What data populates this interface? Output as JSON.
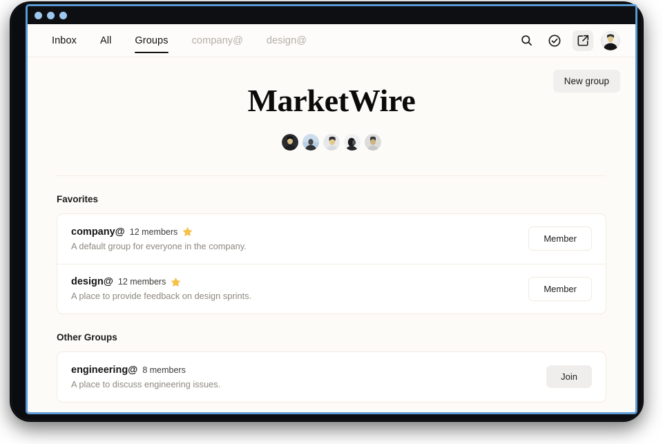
{
  "window": {
    "traffic_lights": [
      "close",
      "minimize",
      "maximize"
    ]
  },
  "nav": {
    "tabs": [
      {
        "label": "Inbox",
        "active": false,
        "muted": false
      },
      {
        "label": "All",
        "active": false,
        "muted": false
      },
      {
        "label": "Groups",
        "active": true,
        "muted": false
      },
      {
        "label": "company@",
        "active": false,
        "muted": true
      },
      {
        "label": "design@",
        "active": false,
        "muted": true
      }
    ],
    "actions": [
      {
        "icon": "search-icon",
        "label": "Search"
      },
      {
        "icon": "check-circle-icon",
        "label": "Done"
      },
      {
        "icon": "compose-icon",
        "label": "Compose"
      }
    ],
    "avatar": "user-avatar"
  },
  "hero": {
    "title": "MarketWire",
    "new_group_label": "New group",
    "member_avatar_count": 5
  },
  "sections": [
    {
      "title": "Favorites",
      "groups": [
        {
          "name": "company@",
          "members": "12 members",
          "favorite": true,
          "star": "★",
          "description": "A default group for everyone in the company.",
          "action_label": "Member",
          "action_style": "outline"
        },
        {
          "name": "design@",
          "members": "12 members",
          "favorite": true,
          "star": "★",
          "description": "A place to provide feedback on design sprints.",
          "action_label": "Member",
          "action_style": "outline"
        }
      ]
    },
    {
      "title": "Other Groups",
      "groups": [
        {
          "name": "engineering@",
          "members": "8 members",
          "favorite": false,
          "star": "",
          "description": "A place to discuss engineering issues.",
          "action_label": "Join",
          "action_style": "solid"
        }
      ]
    }
  ],
  "colors": {
    "page_bg": "#fdfbf7",
    "card_bg": "#ffffff",
    "accent_underline": "#111111",
    "star": "#f6c344",
    "frame_border": "#5b9bd5",
    "muted_text": "#b4aea6"
  }
}
